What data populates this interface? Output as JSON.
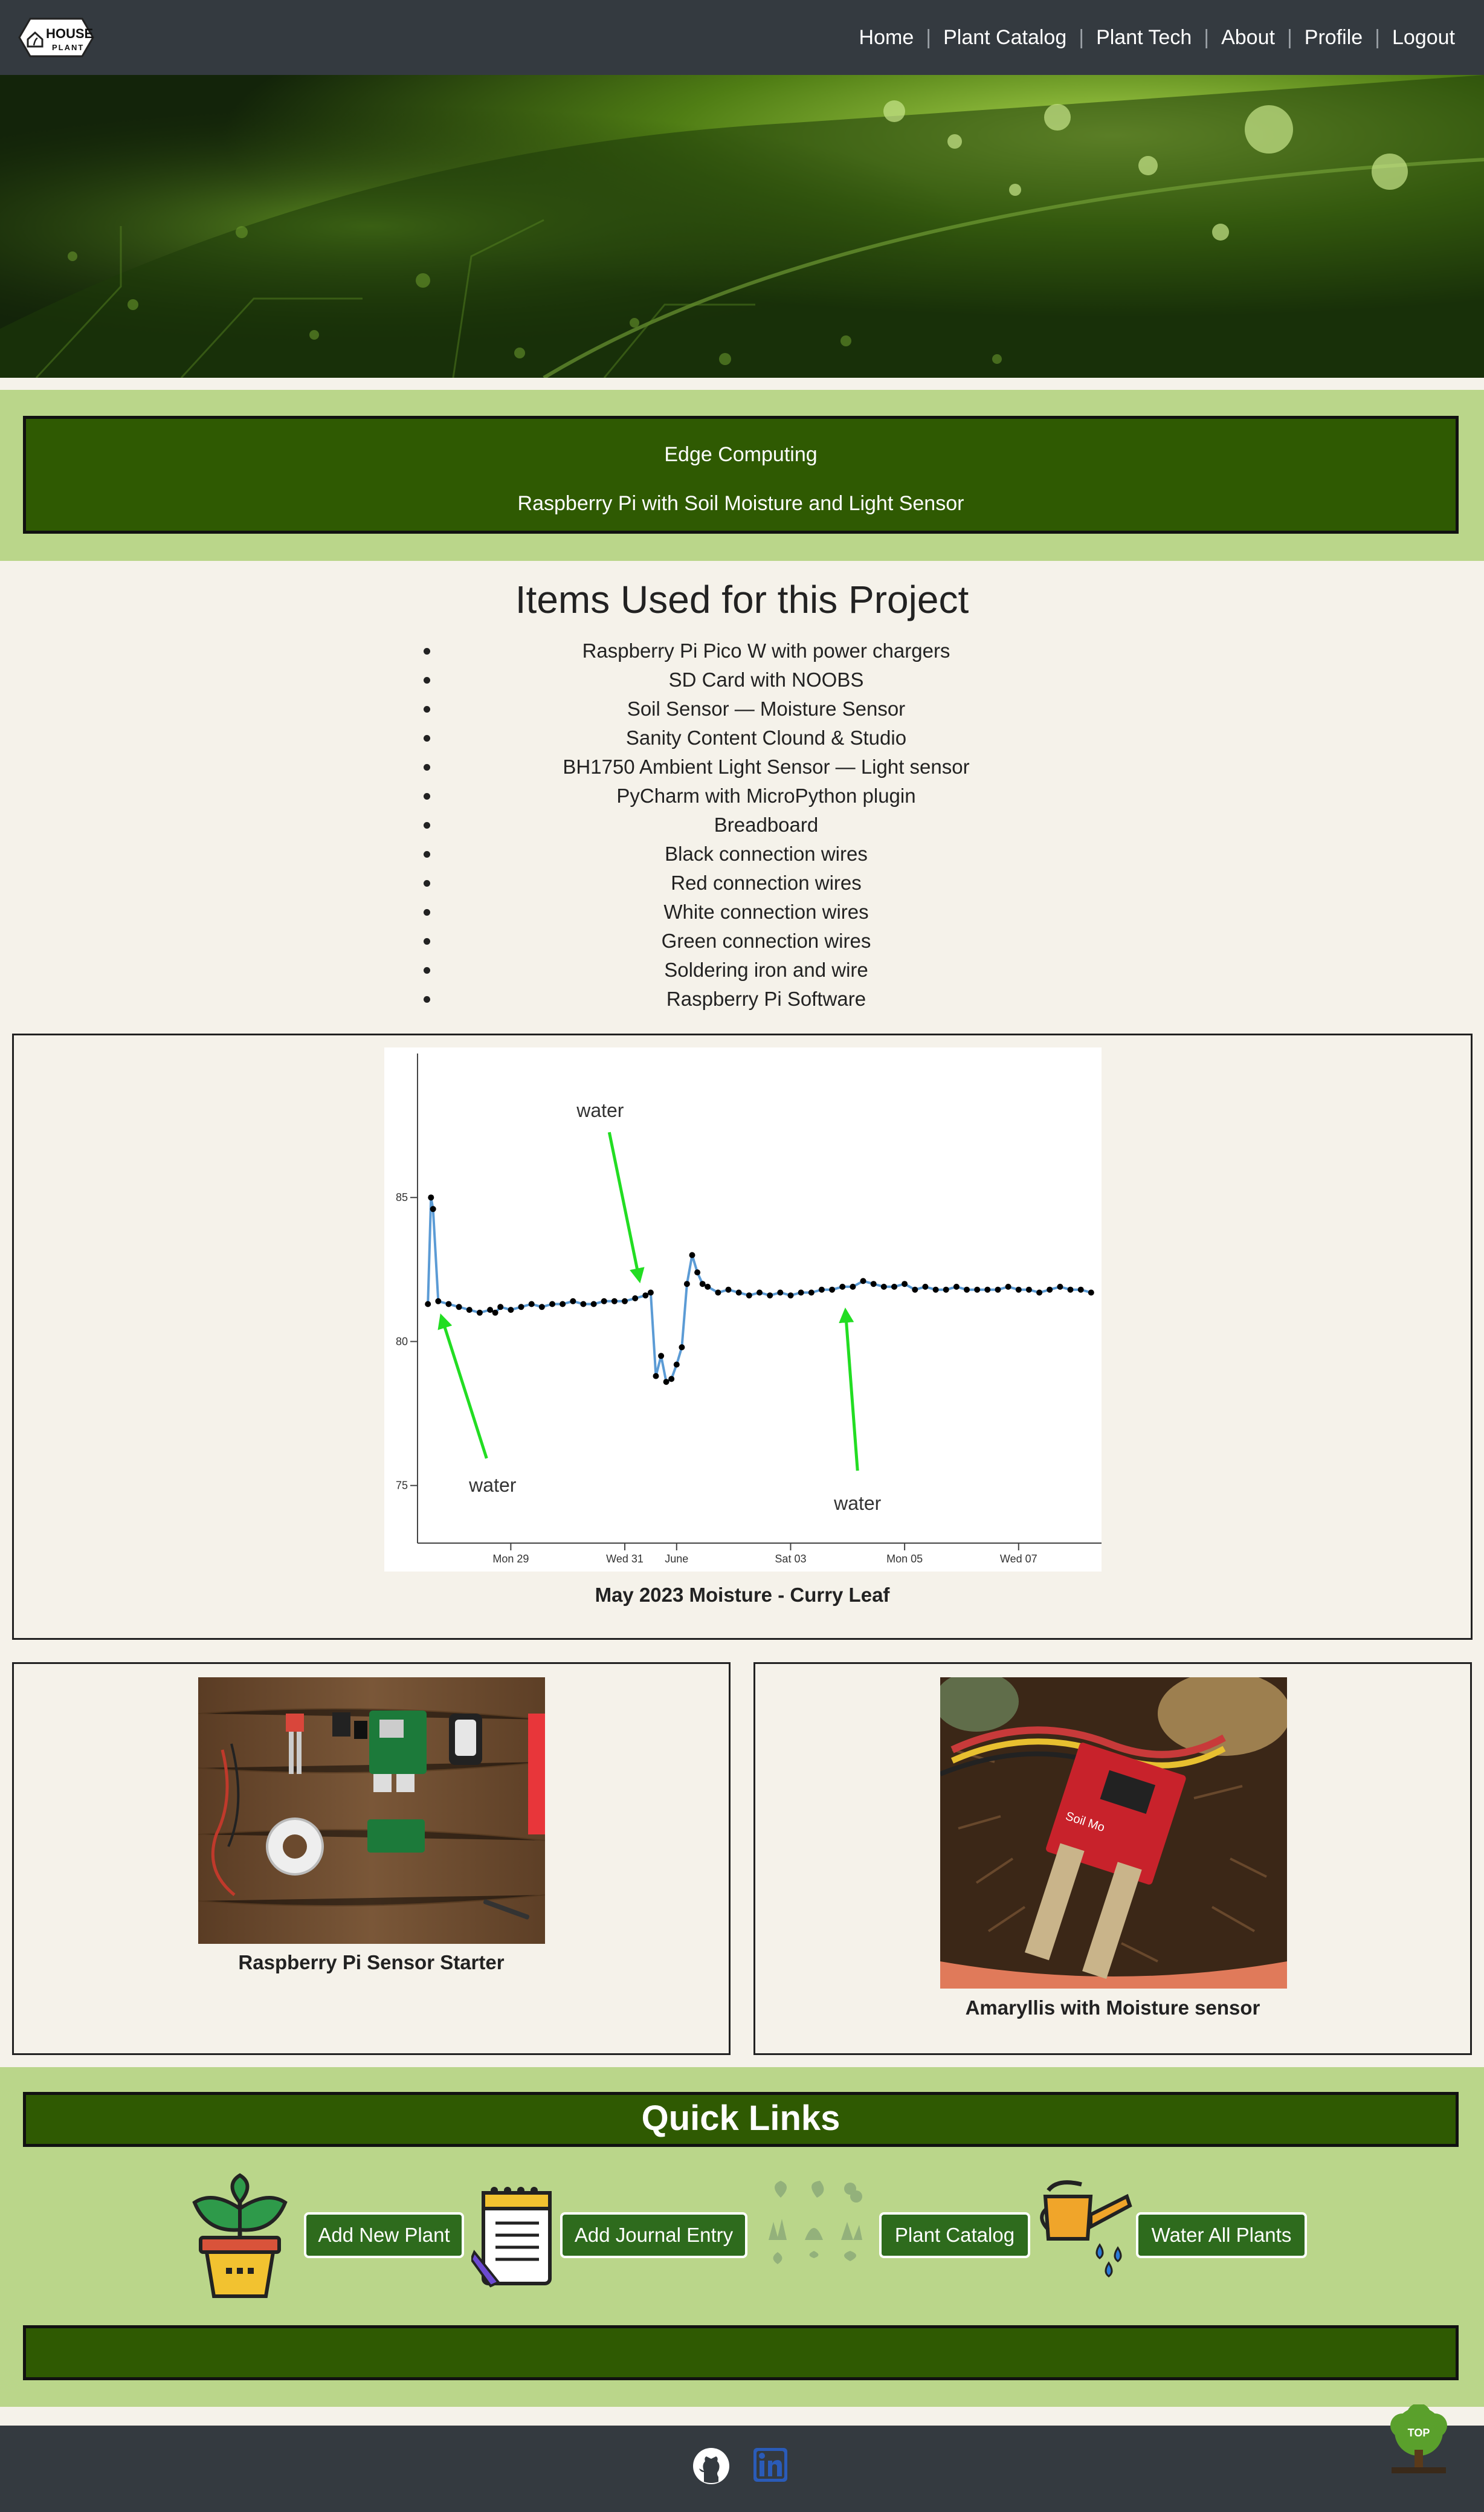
{
  "brand": {
    "logo_top": "HOUSE",
    "logo_bottom": "PLANT"
  },
  "nav": {
    "items": [
      {
        "label": "Home"
      },
      {
        "label": "Plant Catalog"
      },
      {
        "label": "Plant Tech"
      },
      {
        "label": "About"
      },
      {
        "label": "Profile"
      },
      {
        "label": "Logout"
      }
    ]
  },
  "header": {
    "title": "Edge Computing",
    "subtitle": "Raspberry Pi with Soil Moisture and Light Sensor"
  },
  "items_section": {
    "heading": "Items Used for this Project",
    "items": [
      "Raspberry Pi Pico W with power chargers",
      "SD Card with NOOBS",
      "Soil Sensor — Moisture Sensor",
      "Sanity Content Clound & Studio",
      "BH1750 Ambient Light Sensor — Light sensor",
      "PyCharm with MicroPython plugin",
      "Breadboard",
      "Black connection wires",
      "Red connection wires",
      "White connection wires",
      "Green connection wires",
      "Soldering iron and wire",
      "Raspberry Pi Software"
    ]
  },
  "chart_card": {
    "caption": "May 2023 Moisture - Curry Leaf"
  },
  "chart_data": {
    "type": "line",
    "title": "",
    "xlabel": "",
    "ylabel": "",
    "x_ticks": [
      "Mon 29",
      "Wed 31",
      "June",
      "Sat 03",
      "Mon 05",
      "Wed 07"
    ],
    "y_ticks": [
      75,
      80,
      85
    ],
    "ylim": [
      73,
      90
    ],
    "grid": false,
    "series": [
      {
        "x": [
          0,
          0.3,
          0.5,
          1,
          2,
          3,
          4,
          5,
          6,
          6.5,
          7,
          8,
          9,
          10,
          11,
          12,
          13,
          14,
          15,
          16,
          17,
          18,
          19,
          20,
          21,
          21.5,
          22,
          22.5,
          23,
          23.5,
          24,
          24.5,
          25,
          25.5,
          26,
          26.5,
          27,
          28,
          29,
          30,
          31,
          32,
          33,
          34,
          35,
          36,
          37,
          38,
          39,
          40,
          41,
          42,
          43,
          44,
          45,
          46,
          47,
          48,
          49,
          50,
          51,
          52,
          53,
          54,
          55,
          56,
          57,
          58,
          59,
          60,
          61,
          62,
          63,
          64
        ],
        "y": [
          81.3,
          85.0,
          84.6,
          81.4,
          81.3,
          81.2,
          81.1,
          81.0,
          81.1,
          81.0,
          81.2,
          81.1,
          81.2,
          81.3,
          81.2,
          81.3,
          81.3,
          81.4,
          81.3,
          81.3,
          81.4,
          81.4,
          81.4,
          81.5,
          81.6,
          81.7,
          78.8,
          79.5,
          78.6,
          78.7,
          79.2,
          79.8,
          82.0,
          83.0,
          82.4,
          82.0,
          81.9,
          81.7,
          81.8,
          81.7,
          81.6,
          81.7,
          81.6,
          81.7,
          81.6,
          81.7,
          81.7,
          81.8,
          81.8,
          81.9,
          81.9,
          82.1,
          82.0,
          81.9,
          81.9,
          82.0,
          81.8,
          81.9,
          81.8,
          81.8,
          81.9,
          81.8,
          81.8,
          81.8,
          81.8,
          81.9,
          81.8,
          81.8,
          81.7,
          81.8,
          81.9,
          81.8,
          81.8,
          81.7
        ]
      }
    ],
    "annotations": [
      {
        "text": "water",
        "x": 1,
        "y": 81.4,
        "label_position": "below-right"
      },
      {
        "text": "water",
        "x": 21,
        "y": 81.6,
        "label_position": "above-left"
      },
      {
        "text": "water",
        "x": 40,
        "y": 81.6,
        "label_position": "below"
      }
    ],
    "colors": {
      "line": "#5b9bd5",
      "points": "#000000",
      "arrows": "#22dd22"
    }
  },
  "photos": [
    {
      "caption": "Raspberry Pi Sensor Starter"
    },
    {
      "caption": "Amaryllis with Moisture sensor",
      "sensor_label": "Soil Mo"
    }
  ],
  "quick_links": {
    "title": "Quick Links",
    "buttons": [
      {
        "label": "Add New Plant",
        "icon": "potted-plant-icon"
      },
      {
        "label": "Add Journal Entry",
        "icon": "notepad-icon"
      },
      {
        "label": "Plant Catalog",
        "icon": "plant-grid-icon"
      },
      {
        "label": "Water All Plants",
        "icon": "watering-can-icon"
      }
    ]
  },
  "footer": {
    "icons": [
      "github-icon",
      "linkedin-icon"
    ],
    "top_button_label": "TOP"
  },
  "colors": {
    "nav_bg": "#343a40",
    "band_green": "#bad68a",
    "box_green": "#2f5a02",
    "button_green": "#2e6b1d",
    "page_bg": "#f5f2ea"
  }
}
